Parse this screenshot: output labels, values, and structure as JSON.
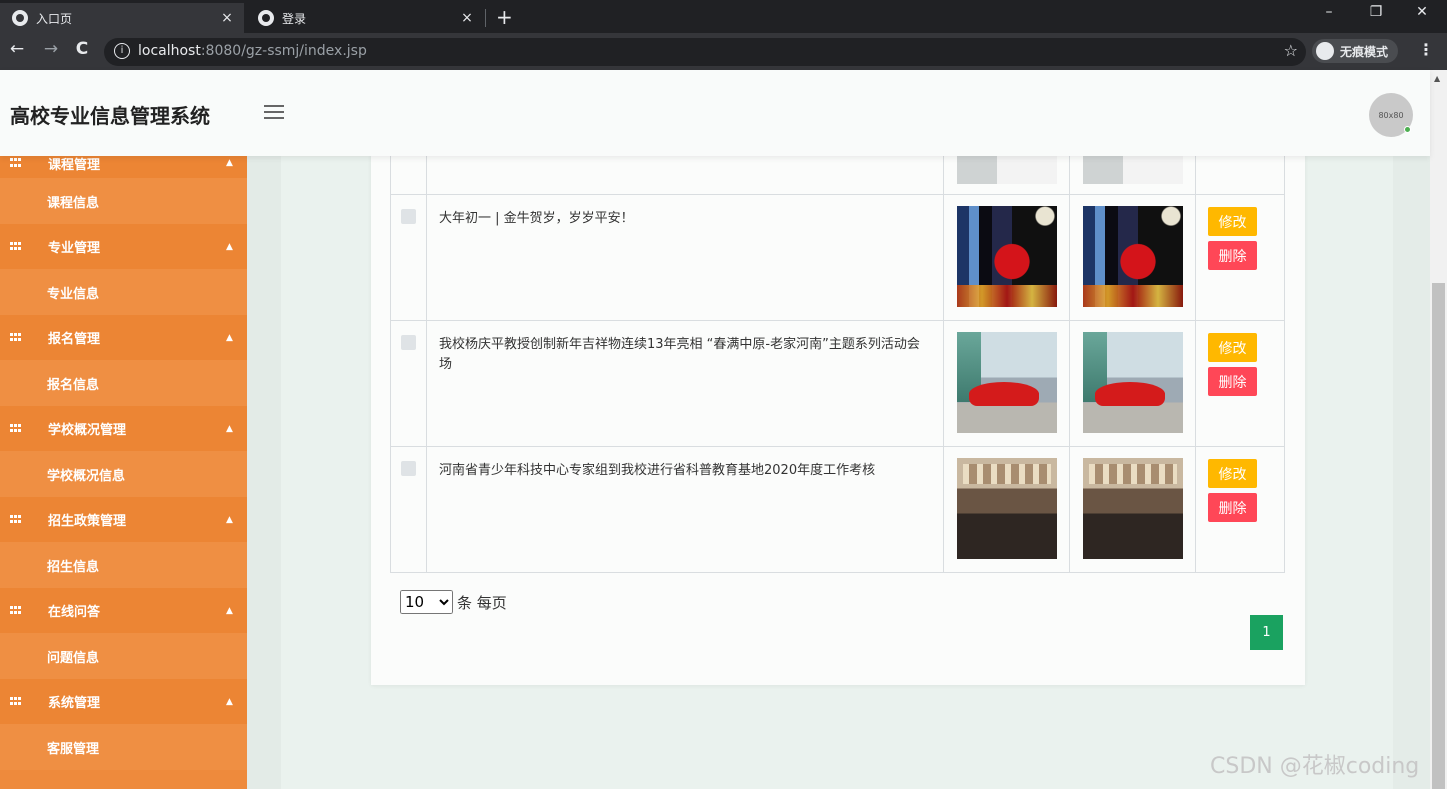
{
  "browser": {
    "tabs": [
      {
        "title": "入口页",
        "close": "×"
      },
      {
        "title": "登录",
        "close": "×"
      }
    ],
    "new_tab": "+",
    "window_controls": [
      "–",
      "❐",
      "✕"
    ],
    "nav": {
      "back": "←",
      "forward": "→",
      "reload": "C"
    },
    "url_host": "localhost",
    "url_path": ":8080/gz-ssmj/index.jsp",
    "info_icon": "i",
    "bookmark_star": "☆",
    "incognito_label": "无痕模式",
    "menu": "⋮"
  },
  "app": {
    "title": "高校专业信息管理系统",
    "avatar_text": "80x80"
  },
  "sidebar": {
    "groups": [
      {
        "label": "课程管理",
        "caret": "▲",
        "item": "课程信息"
      },
      {
        "label": "专业管理",
        "caret": "▲",
        "item": "专业信息"
      },
      {
        "label": "报名管理",
        "caret": "▲",
        "item": "报名信息"
      },
      {
        "label": "学校概况管理",
        "caret": "▲",
        "item": "学校概况信息"
      },
      {
        "label": "招生政策管理",
        "caret": "▲",
        "item": "招生信息"
      },
      {
        "label": "在线问答",
        "caret": "▲",
        "item": "问题信息"
      },
      {
        "label": "系统管理",
        "caret": "▲",
        "item": "客服管理"
      }
    ]
  },
  "table": {
    "rows": [
      {
        "title": "大年初一 | 金牛贺岁，岁岁平安！",
        "edit": "修改",
        "delete": "删除"
      },
      {
        "title": "我校杨庆平教授创制新年吉祥物连续13年亮相 “春满中原-老家河南”主题系列活动会场",
        "edit": "修改",
        "delete": "删除"
      },
      {
        "title": "河南省青少年科技中心专家组到我校进行省科普教育基地2020年度工作考核",
        "edit": "修改",
        "delete": "删除"
      }
    ]
  },
  "pagination": {
    "page_size": "10",
    "page_size_options": [
      "10"
    ],
    "page_size_suffix": "条 每页",
    "current_page": "1"
  },
  "watermark": "CSDN @花椒coding"
}
